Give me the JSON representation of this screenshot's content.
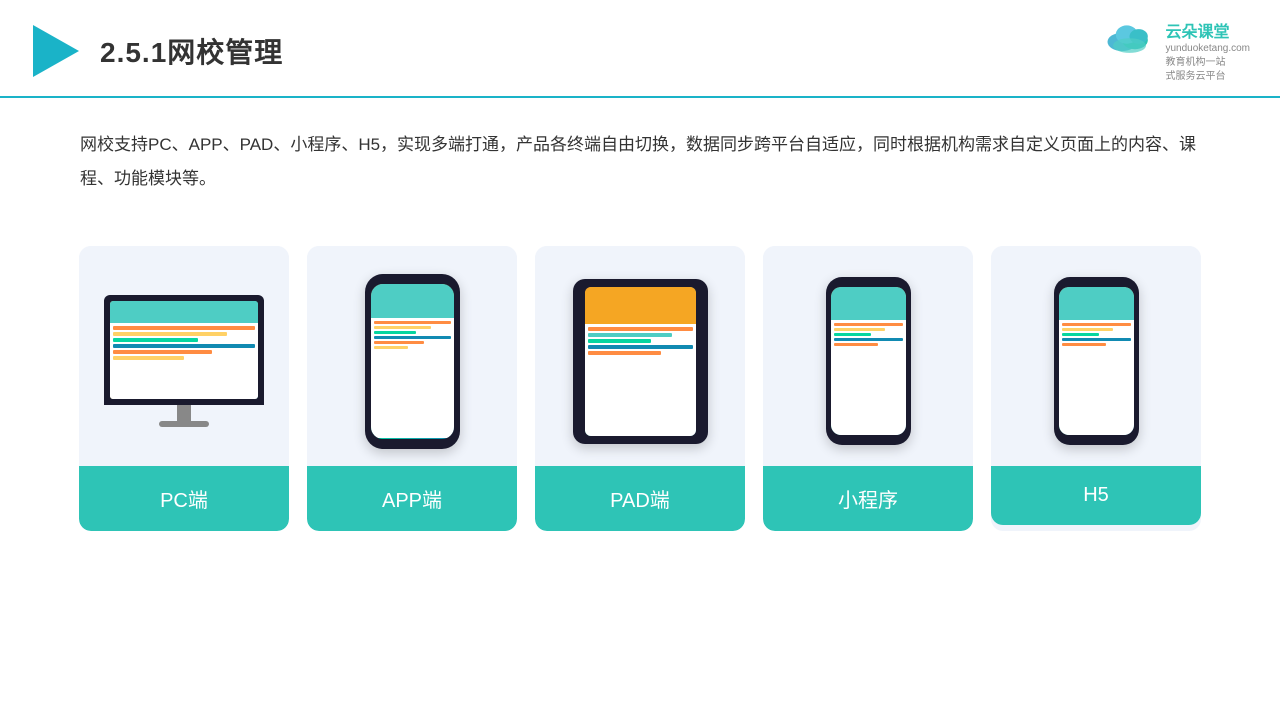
{
  "header": {
    "title": "2.5.1网校管理",
    "brand": {
      "name": "云朵课堂",
      "url": "yunduoketang.com",
      "tagline": "教育机构一站\n式服务云平台"
    }
  },
  "description": "网校支持PC、APP、PAD、小程序、H5，实现多端打通，产品各终端自由切换，数据同步跨平台自适应，同时根据机构需求自定义页面上的内容、课程、功能模块等。",
  "cards": [
    {
      "id": "pc",
      "label": "PC端",
      "device": "pc"
    },
    {
      "id": "app",
      "label": "APP端",
      "device": "phone"
    },
    {
      "id": "pad",
      "label": "PAD端",
      "device": "tablet"
    },
    {
      "id": "miniapp",
      "label": "小程序",
      "device": "miniphone"
    },
    {
      "id": "h5",
      "label": "H5",
      "device": "miniphone2"
    }
  ],
  "colors": {
    "accent": "#1ab3c8",
    "card_bg": "#f0f4fb",
    "label_bg": "#2ec4b6",
    "label_text": "#ffffff",
    "title_text": "#333333",
    "desc_text": "#333333"
  }
}
